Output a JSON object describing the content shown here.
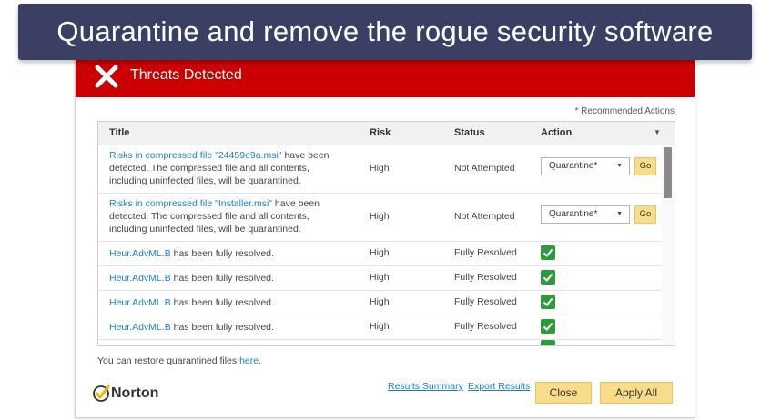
{
  "banner": {
    "text": "Quarantine and remove the rogue security software"
  },
  "window": {
    "title": "Threats Detected",
    "recommended_note": "* Recommended Actions",
    "columns": {
      "title": "Title",
      "risk": "Risk",
      "status": "Status",
      "action": "Action"
    },
    "rows": [
      {
        "link": "Risks in compressed file \"24459e9a.msi\"",
        "rest": " have been detected. The compressed file and all contents, including uninfected files, will be quarantined.",
        "risk": "High",
        "status": "Not Attempted",
        "action_select": "Quarantine*",
        "go_label": "Go"
      },
      {
        "link": "Risks in compressed file \"Installer.msi\"",
        "rest": " have been detected. The compressed file and all contents, including uninfected files, will be quarantined.",
        "risk": "High",
        "status": "Not Attempted",
        "action_select": "Quarantine*",
        "go_label": "Go"
      },
      {
        "link": "Heur.AdvML.B",
        "rest": " has been fully resolved.",
        "risk": "High",
        "status": "Fully Resolved"
      },
      {
        "link": "Heur.AdvML.B",
        "rest": " has been fully resolved.",
        "risk": "High",
        "status": "Fully Resolved"
      },
      {
        "link": "Heur.AdvML.B",
        "rest": " has been fully resolved.",
        "risk": "High",
        "status": "Fully Resolved"
      },
      {
        "link": "Heur.AdvML.B",
        "rest": " has been fully resolved.",
        "risk": "High",
        "status": "Fully Resolved"
      }
    ],
    "restore": {
      "text": "You can restore quarantined files ",
      "link": "here",
      "suffix": "."
    },
    "brand": "Norton",
    "links": {
      "results_summary": "Results Summary",
      "export_results": "Export Results"
    },
    "buttons": {
      "close": "Close",
      "apply_all": "Apply All"
    }
  },
  "colors": {
    "title_bar": "#cc0000",
    "banner": "#3a3f63",
    "link": "#1e7fc8",
    "button": "#f7dc8a",
    "check": "#2d9a3e"
  },
  "icons": {
    "title_icon": "close-x-icon",
    "resolved_icon": "check-icon",
    "select_icon": "caret-down-icon",
    "brand_icon": "norton-check-icon"
  }
}
